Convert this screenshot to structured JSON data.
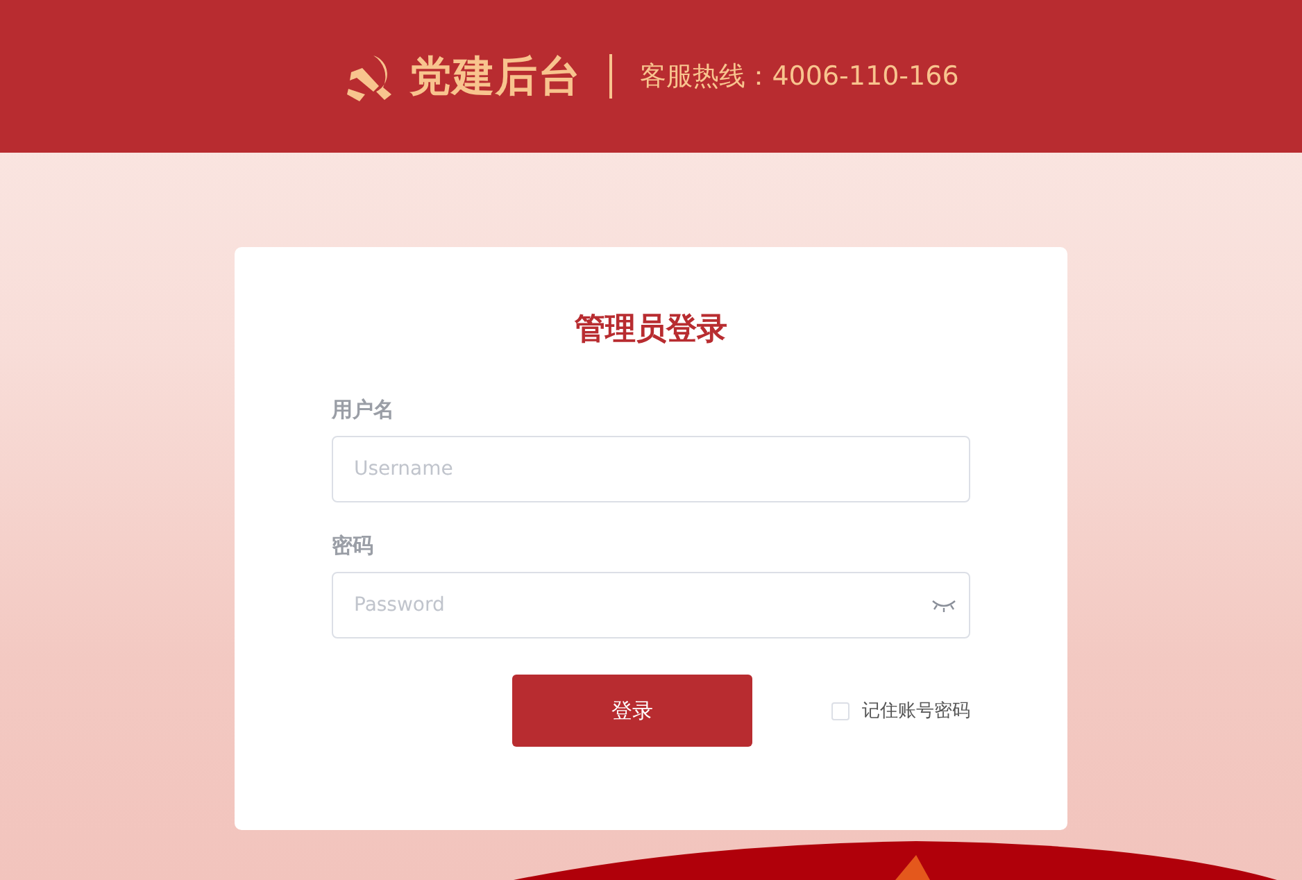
{
  "header": {
    "brand": "党建后台",
    "hotline": "客服热线：4006-110-166"
  },
  "login": {
    "title": "管理员登录",
    "fields": [
      {
        "kind": "text",
        "label": "用户名",
        "placeholder": "Username"
      },
      {
        "kind": "password",
        "label": "密码",
        "placeholder": "Password"
      }
    ],
    "submit": "登录",
    "remember": {
      "label": "记住账号密码",
      "checked": false
    }
  }
}
